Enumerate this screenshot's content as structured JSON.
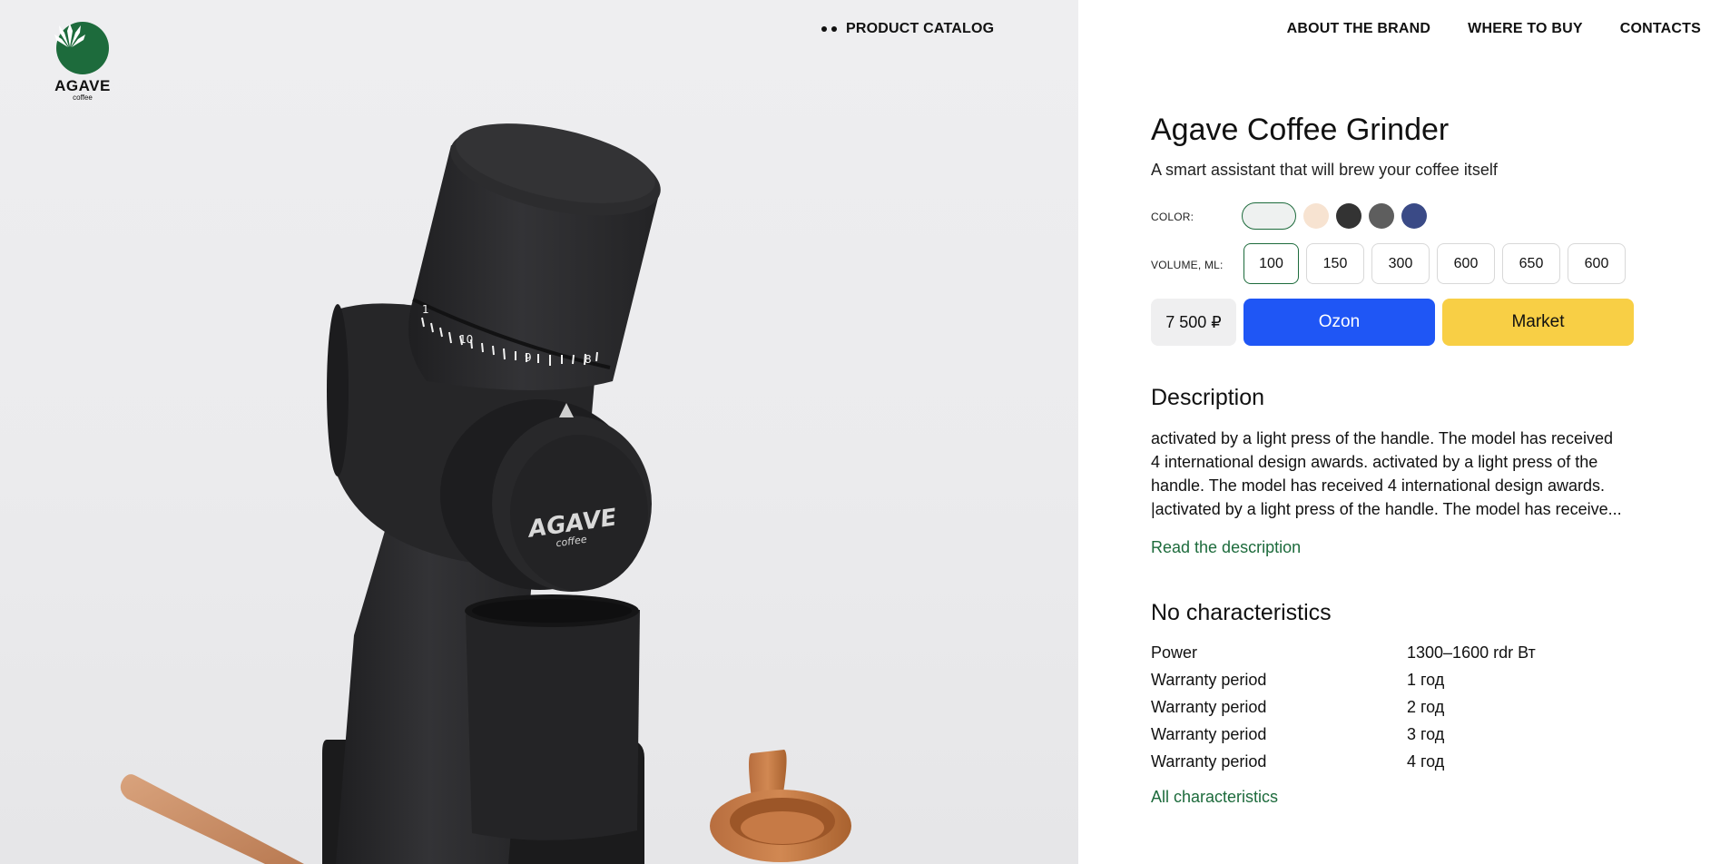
{
  "brand": {
    "name": "AGAVE",
    "sub": "coffee",
    "accent": "#1d6b3c"
  },
  "nav": {
    "catalog": "PRODUCT CATALOG",
    "links": [
      "ABOUT THE BRAND",
      "WHERE TO BUY",
      "CONTACTS"
    ]
  },
  "product": {
    "title": "Agave Coffee Grinder",
    "subtitle": "A smart assistant that will brew your coffee itself",
    "color_label": "COLOR:",
    "colors": [
      "#eef1f0",
      "#f7e3d1",
      "#333333",
      "#5e5e5e",
      "#3a4a86"
    ],
    "selected_color": "#eef1f0",
    "volume_label": "VOLUME, ML:",
    "volumes": [
      "100",
      "150",
      "300",
      "600",
      "650",
      "600"
    ],
    "selected_volume": "100",
    "price": "7 500 ₽",
    "buttons": {
      "ozon": "Ozon",
      "market": "Market",
      "ozon_color": "#1f56f5",
      "market_color": "#f8cf45"
    }
  },
  "description": {
    "heading": "Description",
    "lines": [
      "activated by a light press of the handle. The model has received",
      "4 international design awards. activated by a light press of the",
      "handle. The model has received 4 international design awards.",
      "|activated by a light press of the handle. The model has receive..."
    ],
    "read_more": "Read the description"
  },
  "characteristics": {
    "heading": "No characteristics",
    "rows": [
      {
        "name": "Power",
        "value": "1300–1600 rdr Вт"
      },
      {
        "name": "Warranty period",
        "value": "1 год"
      },
      {
        "name": "Warranty period",
        "value": "2 год"
      },
      {
        "name": "Warranty period",
        "value": "3 год"
      },
      {
        "name": "Warranty period",
        "value": "4 год"
      }
    ],
    "all_link": "All characteristics"
  },
  "photo": {
    "grinder_logo": "AGAVE",
    "grinder_logo_sub": "coffee",
    "dial_numbers": [
      "1",
      "10",
      "9",
      "8"
    ]
  }
}
